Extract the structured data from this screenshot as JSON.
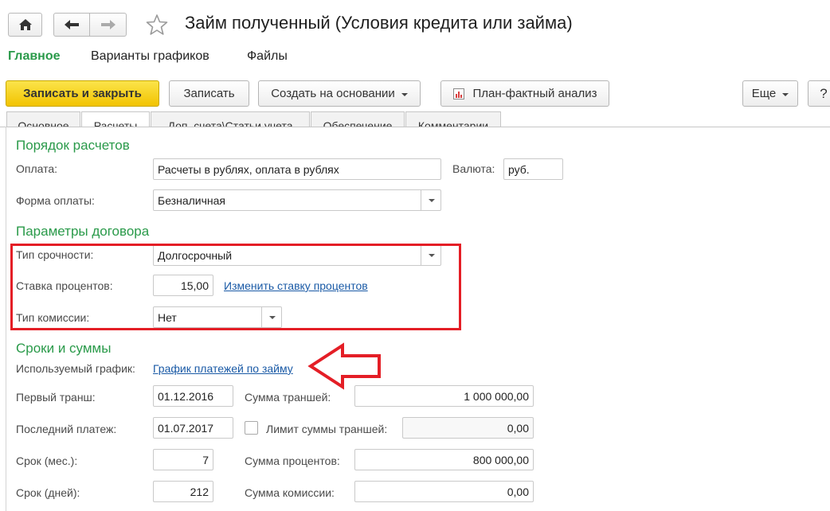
{
  "window": {
    "title": "Займ полученный (Условия кредита или займа)"
  },
  "nav": {
    "home_icon": "home-icon",
    "back_icon": "arrow-left-icon",
    "forward_icon": "arrow-right-icon",
    "favorite_icon": "star-icon"
  },
  "sections": {
    "main": "Главное",
    "schedules": "Варианты графиков",
    "files": "Файлы"
  },
  "toolbar": {
    "save_close": "Записать и закрыть",
    "save": "Записать",
    "create_based": "Создать на основании",
    "plan_fact": "План-фактный анализ",
    "more": "Еще",
    "help": "?"
  },
  "tabs": [
    {
      "label": "Основное"
    },
    {
      "label": "Расчеты"
    },
    {
      "label": "Доп. счета\\Статьи учета"
    },
    {
      "label": "Обеспечение"
    },
    {
      "label": "Комментарии"
    }
  ],
  "settlement": {
    "header": "Порядок расчетов",
    "payment_label": "Оплата:",
    "payment_value": "Расчеты в рублях, оплата в рублях",
    "currency_label": "Валюта:",
    "currency_value": "руб.",
    "form_label": "Форма оплаты:",
    "form_value": "Безналичная"
  },
  "contract": {
    "header": "Параметры договора",
    "term_type_label": "Тип срочности:",
    "term_type_value": "Долгосрочный",
    "rate_label": "Ставка процентов:",
    "rate_value": "15,00",
    "change_rate_link": "Изменить ставку процентов",
    "commission_label": "Тип комиссии:",
    "commission_value": "Нет"
  },
  "terms": {
    "header": "Сроки и суммы",
    "schedule_label": "Используемый график:",
    "schedule_link": "График платежей по займу",
    "first_tranche_label": "Первый транш:",
    "first_tranche_value": "01.12.2016",
    "tranche_sum_label": "Сумма траншей:",
    "tranche_sum_value": "1 000 000,00",
    "last_payment_label": "Последний платеж:",
    "last_payment_value": "01.07.2017",
    "limit_label": "Лимит суммы траншей:",
    "limit_value": "0,00",
    "term_months_label": "Срок (мес.):",
    "term_months_value": "7",
    "interest_sum_label": "Сумма процентов:",
    "interest_sum_value": "800 000,00",
    "term_days_label": "Срок (дней):",
    "term_days_value": "212",
    "commission_sum_label": "Сумма комиссии:",
    "commission_sum_value": "0,00"
  },
  "colors": {
    "accent_green": "#2a9a4a",
    "primary_yellow": "#f2c300",
    "link_blue": "#1a5aa6",
    "highlight_red": "#e41e26"
  }
}
